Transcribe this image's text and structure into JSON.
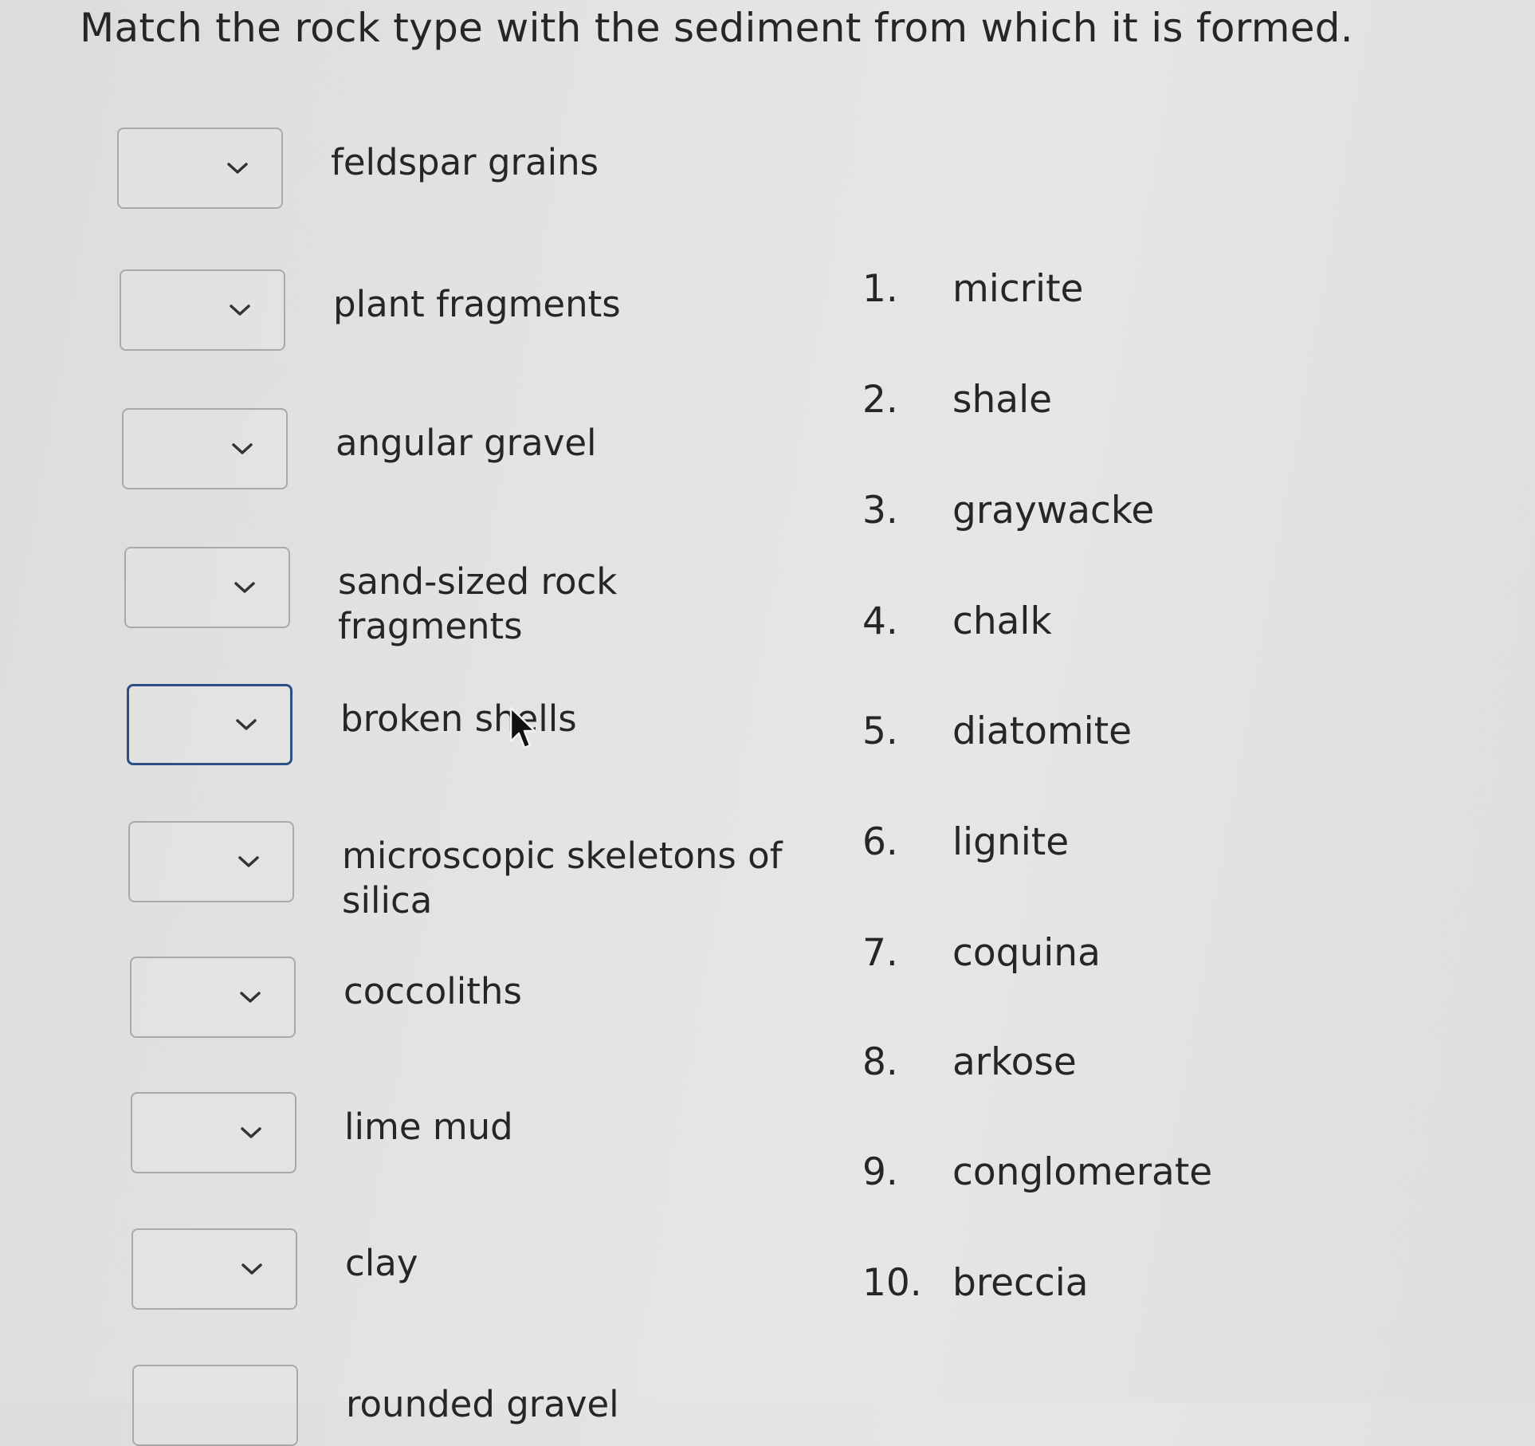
{
  "question": {
    "text": "Match the rock type with the sediment from which it is formed."
  },
  "prompts": [
    {
      "label": "feldspar grains",
      "selected": ""
    },
    {
      "label": "plant fragments",
      "selected": ""
    },
    {
      "label": "angular gravel",
      "selected": ""
    },
    {
      "label": "sand-sized rock fragments",
      "selected": ""
    },
    {
      "label": "broken shells",
      "selected": ""
    },
    {
      "label": "microscopic skeletons of silica",
      "selected": ""
    },
    {
      "label": "coccoliths",
      "selected": ""
    },
    {
      "label": "lime mud",
      "selected": ""
    },
    {
      "label": "clay",
      "selected": ""
    },
    {
      "label": "rounded gravel",
      "selected": ""
    }
  ],
  "options": [
    {
      "num": "1.",
      "label": "micrite"
    },
    {
      "num": "2.",
      "label": "shale"
    },
    {
      "num": "3.",
      "label": "graywacke"
    },
    {
      "num": "4.",
      "label": "chalk"
    },
    {
      "num": "5.",
      "label": "diatomite"
    },
    {
      "num": "6.",
      "label": "lignite"
    },
    {
      "num": "7.",
      "label": "coquina"
    },
    {
      "num": "8.",
      "label": "arkose"
    },
    {
      "num": "9.",
      "label": "conglomerate"
    },
    {
      "num": "10.",
      "label": "breccia"
    }
  ],
  "icons": {
    "dropdown": "chevron-down-icon",
    "cursor": "mouse-pointer-icon"
  },
  "colors": {
    "focus_border": "#2d4f86",
    "text": "#262626"
  }
}
